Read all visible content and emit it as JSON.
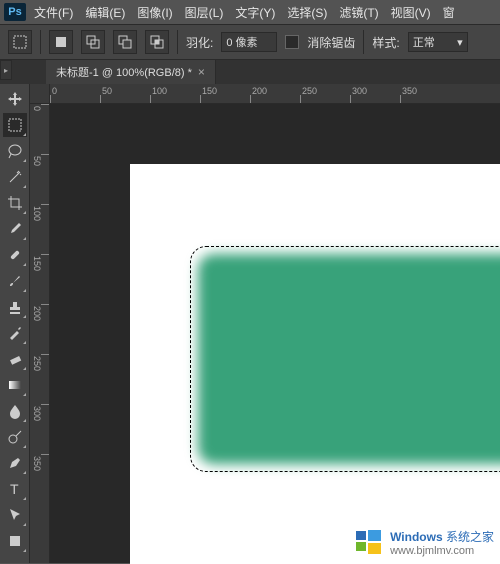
{
  "app": {
    "logo_text": "Ps"
  },
  "menu": [
    "文件(F)",
    "编辑(E)",
    "图像(I)",
    "图层(L)",
    "文字(Y)",
    "选择(S)",
    "滤镜(T)",
    "视图(V)",
    "窗"
  ],
  "options": {
    "feather_label": "羽化:",
    "feather_value": "0 像素",
    "antialias_label": "消除锯齿",
    "antialias_checked": false,
    "style_label": "样式:",
    "style_value": "正常"
  },
  "document": {
    "tab_label": "未标题-1 @ 100%(RGB/8) *",
    "ruler_h_ticks": [
      0,
      50,
      100,
      150,
      200,
      250,
      300,
      350
    ],
    "ruler_v_ticks": [
      0,
      50,
      100,
      150,
      200,
      250,
      300,
      350
    ]
  },
  "tools": [
    {
      "name": "move-tool",
      "icon": "move",
      "flyout": false
    },
    {
      "name": "marquee-tool",
      "icon": "marquee",
      "flyout": true,
      "selected": true
    },
    {
      "name": "lasso-tool",
      "icon": "lasso",
      "flyout": true
    },
    {
      "name": "wand-tool",
      "icon": "wand",
      "flyout": true
    },
    {
      "name": "crop-tool",
      "icon": "crop",
      "flyout": true
    },
    {
      "name": "eyedropper-tool",
      "icon": "eyedropper",
      "flyout": true
    },
    {
      "name": "healing-tool",
      "icon": "healing",
      "flyout": true
    },
    {
      "name": "brush-tool",
      "icon": "brush",
      "flyout": true
    },
    {
      "name": "stamp-tool",
      "icon": "stamp",
      "flyout": true
    },
    {
      "name": "history-brush-tool",
      "icon": "hbrush",
      "flyout": true
    },
    {
      "name": "eraser-tool",
      "icon": "eraser",
      "flyout": true
    },
    {
      "name": "gradient-tool",
      "icon": "gradient",
      "flyout": true
    },
    {
      "name": "blur-tool",
      "icon": "blur",
      "flyout": true
    },
    {
      "name": "dodge-tool",
      "icon": "dodge",
      "flyout": true
    },
    {
      "name": "pen-tool",
      "icon": "pen",
      "flyout": true
    },
    {
      "name": "type-tool",
      "icon": "type",
      "flyout": true
    },
    {
      "name": "path-select-tool",
      "icon": "pathsel",
      "flyout": true
    },
    {
      "name": "shape-tool",
      "icon": "shape",
      "flyout": true
    }
  ],
  "watermark": {
    "line1_a": "Windows",
    "line1_b": "系统之家",
    "line2": "www.bjmlmv.com"
  },
  "colors": {
    "accent": "#38a27a",
    "canvas_bg": "#ffffff",
    "ui_bg": "#454545"
  },
  "chart_data": null
}
